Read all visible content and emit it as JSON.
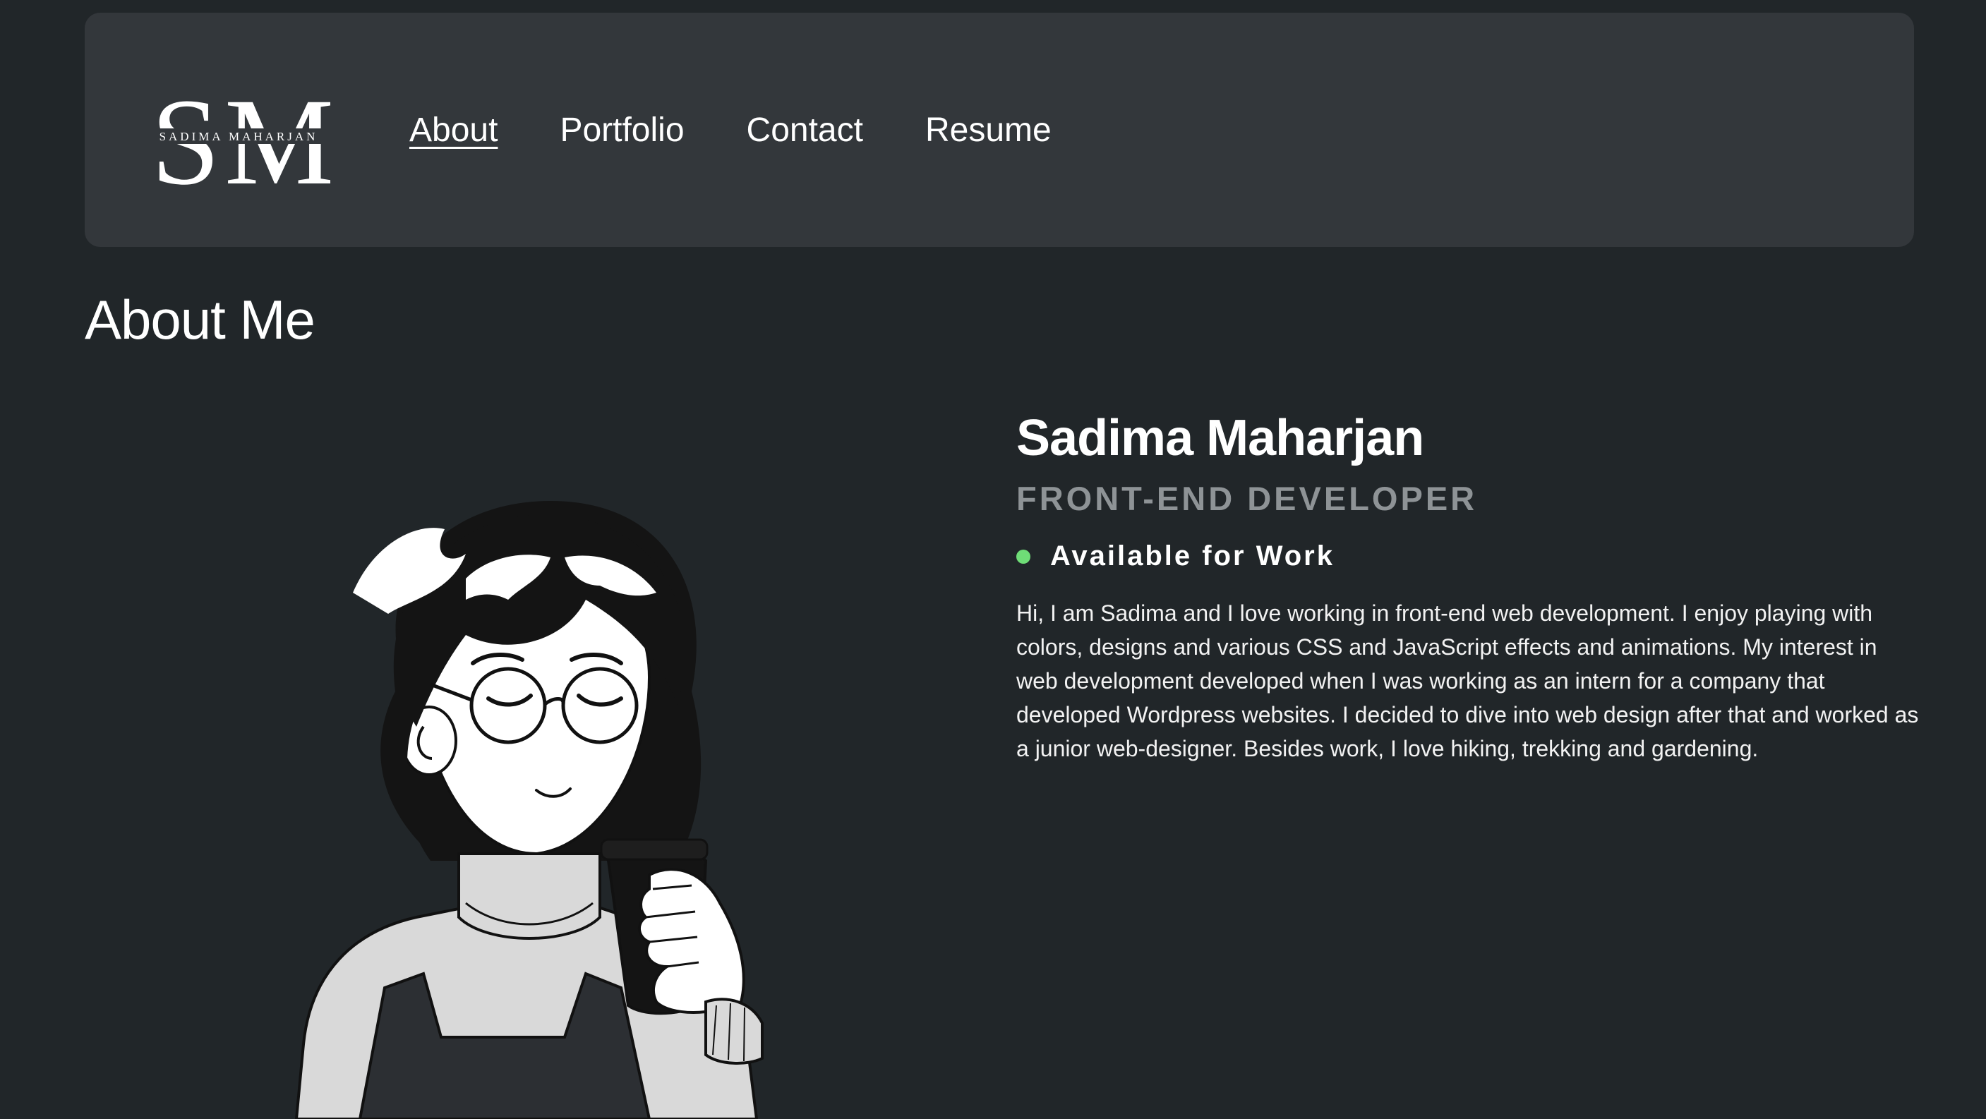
{
  "logo": {
    "initials_first": "S",
    "initials_second": "M",
    "subtitle": "SADIMA MAHARJAN"
  },
  "nav": {
    "items": [
      {
        "label": "About",
        "active": true
      },
      {
        "label": "Portfolio",
        "active": false
      },
      {
        "label": "Contact",
        "active": false
      },
      {
        "label": "Resume",
        "active": false
      }
    ]
  },
  "section": {
    "title": "About Me"
  },
  "profile": {
    "name": "Sadima Maharjan",
    "role": "FRONT-END DEVELOPER",
    "availability": "Available for Work",
    "availability_color": "#6fdd77",
    "bio": "Hi, I am Sadima and I love working in front-end web development. I enjoy playing with colors, designs and various CSS and JavaScript effects and animations. My interest in web development developed when I was working as an intern for a company that developed Wordpress websites. I decided to dive into web design after that and worked as a junior web-designer. Besides work, I love hiking, trekking and gardening."
  },
  "illustration": {
    "subject": "girl-with-glasses-drinking-coffee"
  },
  "colors": {
    "background": "#212629",
    "header": "#33373b",
    "muted_text": "#8e9396",
    "accent_green": "#6fdd77"
  }
}
